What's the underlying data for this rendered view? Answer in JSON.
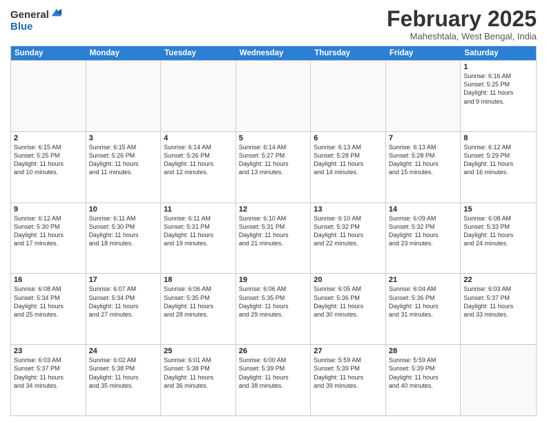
{
  "logo": {
    "general": "General",
    "blue": "Blue"
  },
  "header": {
    "month": "February 2025",
    "location": "Maheshtala, West Bengal, India"
  },
  "days_of_week": [
    "Sunday",
    "Monday",
    "Tuesday",
    "Wednesday",
    "Thursday",
    "Friday",
    "Saturday"
  ],
  "weeks": [
    [
      {
        "day": "",
        "info": ""
      },
      {
        "day": "",
        "info": ""
      },
      {
        "day": "",
        "info": ""
      },
      {
        "day": "",
        "info": ""
      },
      {
        "day": "",
        "info": ""
      },
      {
        "day": "",
        "info": ""
      },
      {
        "day": "1",
        "info": "Sunrise: 6:16 AM\nSunset: 5:25 PM\nDaylight: 11 hours\nand 9 minutes."
      }
    ],
    [
      {
        "day": "2",
        "info": "Sunrise: 6:15 AM\nSunset: 5:25 PM\nDaylight: 11 hours\nand 10 minutes."
      },
      {
        "day": "3",
        "info": "Sunrise: 6:15 AM\nSunset: 5:26 PM\nDaylight: 11 hours\nand 11 minutes."
      },
      {
        "day": "4",
        "info": "Sunrise: 6:14 AM\nSunset: 5:26 PM\nDaylight: 11 hours\nand 12 minutes."
      },
      {
        "day": "5",
        "info": "Sunrise: 6:14 AM\nSunset: 5:27 PM\nDaylight: 11 hours\nand 13 minutes."
      },
      {
        "day": "6",
        "info": "Sunrise: 6:13 AM\nSunset: 5:28 PM\nDaylight: 11 hours\nand 14 minutes."
      },
      {
        "day": "7",
        "info": "Sunrise: 6:13 AM\nSunset: 5:28 PM\nDaylight: 11 hours\nand 15 minutes."
      },
      {
        "day": "8",
        "info": "Sunrise: 6:12 AM\nSunset: 5:29 PM\nDaylight: 11 hours\nand 16 minutes."
      }
    ],
    [
      {
        "day": "9",
        "info": "Sunrise: 6:12 AM\nSunset: 5:30 PM\nDaylight: 11 hours\nand 17 minutes."
      },
      {
        "day": "10",
        "info": "Sunrise: 6:11 AM\nSunset: 5:30 PM\nDaylight: 11 hours\nand 18 minutes."
      },
      {
        "day": "11",
        "info": "Sunrise: 6:11 AM\nSunset: 5:31 PM\nDaylight: 11 hours\nand 19 minutes."
      },
      {
        "day": "12",
        "info": "Sunrise: 6:10 AM\nSunset: 5:31 PM\nDaylight: 11 hours\nand 21 minutes."
      },
      {
        "day": "13",
        "info": "Sunrise: 6:10 AM\nSunset: 5:32 PM\nDaylight: 11 hours\nand 22 minutes."
      },
      {
        "day": "14",
        "info": "Sunrise: 6:09 AM\nSunset: 5:32 PM\nDaylight: 11 hours\nand 23 minutes."
      },
      {
        "day": "15",
        "info": "Sunrise: 6:08 AM\nSunset: 5:33 PM\nDaylight: 11 hours\nand 24 minutes."
      }
    ],
    [
      {
        "day": "16",
        "info": "Sunrise: 6:08 AM\nSunset: 5:34 PM\nDaylight: 11 hours\nand 25 minutes."
      },
      {
        "day": "17",
        "info": "Sunrise: 6:07 AM\nSunset: 5:34 PM\nDaylight: 11 hours\nand 27 minutes."
      },
      {
        "day": "18",
        "info": "Sunrise: 6:06 AM\nSunset: 5:35 PM\nDaylight: 11 hours\nand 28 minutes."
      },
      {
        "day": "19",
        "info": "Sunrise: 6:06 AM\nSunset: 5:35 PM\nDaylight: 11 hours\nand 29 minutes."
      },
      {
        "day": "20",
        "info": "Sunrise: 6:05 AM\nSunset: 5:36 PM\nDaylight: 11 hours\nand 30 minutes."
      },
      {
        "day": "21",
        "info": "Sunrise: 6:04 AM\nSunset: 5:36 PM\nDaylight: 11 hours\nand 31 minutes."
      },
      {
        "day": "22",
        "info": "Sunrise: 6:03 AM\nSunset: 5:37 PM\nDaylight: 11 hours\nand 33 minutes."
      }
    ],
    [
      {
        "day": "23",
        "info": "Sunrise: 6:03 AM\nSunset: 5:37 PM\nDaylight: 11 hours\nand 34 minutes."
      },
      {
        "day": "24",
        "info": "Sunrise: 6:02 AM\nSunset: 5:38 PM\nDaylight: 11 hours\nand 35 minutes."
      },
      {
        "day": "25",
        "info": "Sunrise: 6:01 AM\nSunset: 5:38 PM\nDaylight: 11 hours\nand 36 minutes."
      },
      {
        "day": "26",
        "info": "Sunrise: 6:00 AM\nSunset: 5:39 PM\nDaylight: 11 hours\nand 38 minutes."
      },
      {
        "day": "27",
        "info": "Sunrise: 5:59 AM\nSunset: 5:39 PM\nDaylight: 11 hours\nand 39 minutes."
      },
      {
        "day": "28",
        "info": "Sunrise: 5:59 AM\nSunset: 5:39 PM\nDaylight: 11 hours\nand 40 minutes."
      },
      {
        "day": "",
        "info": ""
      }
    ]
  ]
}
